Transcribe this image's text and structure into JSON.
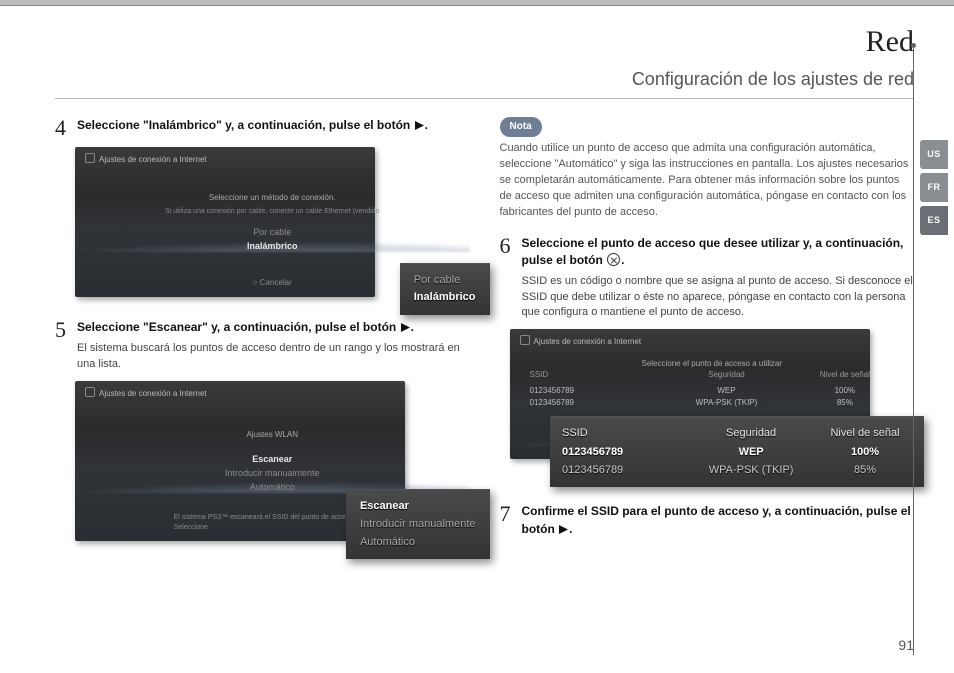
{
  "section_title": "Red",
  "subtitle": "Configuración de los ajustes de red",
  "page_number": "91",
  "tabs": {
    "us": "US",
    "fr": "FR",
    "es": "ES"
  },
  "left": {
    "step4": {
      "num": "4",
      "title_a": "Seleccione \"Inalámbrico\" y, a continuación, pulse el botón ",
      "title_b": ".",
      "screen": {
        "header": "Ajustes de conexión a Internet",
        "line1": "Seleccione un método de conexión.",
        "line2": "Si utiliza una conexión por cable, conecte un cable Ethernet (vendido",
        "opt1": "Por cable",
        "opt2": "Inalámbrico",
        "cancel": "○ Cancelar"
      },
      "callout": {
        "opt1": "Por cable",
        "opt2": "Inalámbrico"
      }
    },
    "step5": {
      "num": "5",
      "title_a": "Seleccione \"Escanear\" y, a continuación, pulse el botón ",
      "title_b": ".",
      "body": "El sistema buscará los puntos de acceso dentro de un rango y los mostrará en una lista.",
      "screen": {
        "header": "Ajustes de conexión a Internet",
        "line1": "Ajustes WLAN",
        "opt1": "Escanear",
        "opt2": "Introducir manualmente",
        "opt3": "Automático",
        "foot": "El sistema PS3™ escaneará el SSID del punto de acceso. Seleccione"
      },
      "callout": {
        "opt1": "Escanear",
        "opt2": "Introducir manualmente",
        "opt3": "Automático"
      }
    }
  },
  "right": {
    "note_label": "Nota",
    "note_text": "Cuando utilice un punto de acceso que admita una configuración automática, seleccione \"Automático\" y siga las instrucciones en pantalla. Los ajustes necesarios se completarán automáticamente. Para obtener más información sobre los puntos de acceso que admiten una configuración automática, póngase en contacto con los fabricantes del punto de acceso.",
    "step6": {
      "num": "6",
      "title_a": "Seleccione el punto de acceso que desee utilizar y, a continuación, pulse el botón ",
      "title_b": ".",
      "body": "SSID es un código o nombre que se asigna al punto de acceso. Si desconoce el SSID que debe utilizar o éste no aparece, póngase en contacto con la persona que configura o mantiene el punto de acceso.",
      "screen": {
        "header": "Ajustes de conexión a Internet",
        "line1": "Seleccione el punto de acceso a utilizar",
        "h1": "SSID",
        "h2": "Seguridad",
        "h3": "Nivel de señal",
        "r1c1": "0123456789",
        "r1c2": "WEP",
        "r1c3": "100%",
        "r2c1": "0123456789",
        "r2c2": "WPA-PSK (TKIP)",
        "r2c3": "85%"
      },
      "callout": {
        "h1": "SSID",
        "h2": "Seguridad",
        "h3": "Nivel de señal",
        "r1c1": "0123456789",
        "r1c2": "WEP",
        "r1c3": "100%",
        "r2c1": "0123456789",
        "r2c2": "WPA-PSK (TKIP)",
        "r2c3": "85%"
      }
    },
    "step7": {
      "num": "7",
      "title_a": "Confirme el SSID para el punto de acceso y, a continuación, pulse el botón ",
      "title_b": "."
    }
  }
}
